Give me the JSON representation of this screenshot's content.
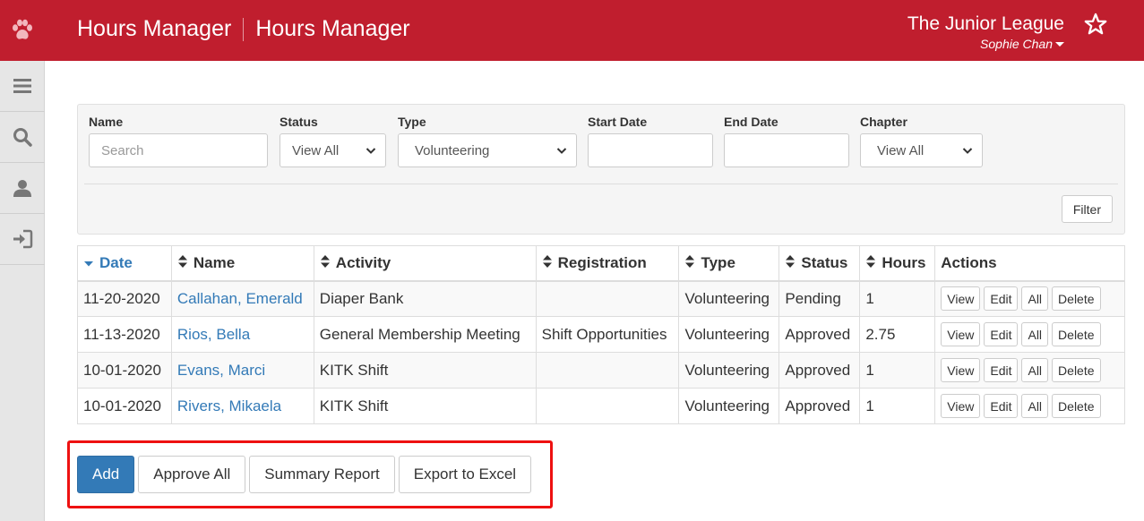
{
  "header": {
    "app_title": "Hours Manager",
    "page_title": "Hours Manager",
    "org_name": "The Junior League",
    "user_name": "Sophie Chan",
    "brand_color": "#c01e2e"
  },
  "sidebar": {
    "items": [
      {
        "icon": "menu-icon"
      },
      {
        "icon": "search-icon"
      },
      {
        "icon": "user-icon"
      },
      {
        "icon": "sign-in-icon"
      }
    ]
  },
  "filters": {
    "name": {
      "label": "Name",
      "placeholder": "Search",
      "value": ""
    },
    "status": {
      "label": "Status",
      "value": "View All"
    },
    "type": {
      "label": "Type",
      "value": "Volunteering"
    },
    "start_date": {
      "label": "Start Date",
      "value": ""
    },
    "end_date": {
      "label": "End Date",
      "value": ""
    },
    "chapter": {
      "label": "Chapter",
      "value": "View All"
    },
    "filter_button": "Filter"
  },
  "table": {
    "columns": [
      "Date",
      "Name",
      "Activity",
      "Registration",
      "Type",
      "Status",
      "Hours",
      "Actions"
    ],
    "rows": [
      {
        "date": "11-20-2020",
        "name": "Callahan, Emerald",
        "activity": "Diaper Bank",
        "registration": "",
        "type": "Volunteering",
        "status": "Pending",
        "hours": "1"
      },
      {
        "date": "11-13-2020",
        "name": "Rios, Bella",
        "activity": "General Membership Meeting",
        "registration": "Shift Opportunities",
        "type": "Volunteering",
        "status": "Approved",
        "hours": "2.75"
      },
      {
        "date": "10-01-2020",
        "name": "Evans, Marci",
        "activity": "KITK Shift",
        "registration": "",
        "type": "Volunteering",
        "status": "Approved",
        "hours": "1"
      },
      {
        "date": "10-01-2020",
        "name": "Rivers, Mikaela",
        "activity": "KITK Shift",
        "registration": "",
        "type": "Volunteering",
        "status": "Approved",
        "hours": "1"
      }
    ],
    "actions": {
      "view": "View",
      "edit": "Edit",
      "all": "All",
      "delete": "Delete"
    }
  },
  "bottom_buttons": {
    "add": "Add",
    "approve_all": "Approve All",
    "summary_report": "Summary Report",
    "export_excel": "Export to Excel"
  }
}
